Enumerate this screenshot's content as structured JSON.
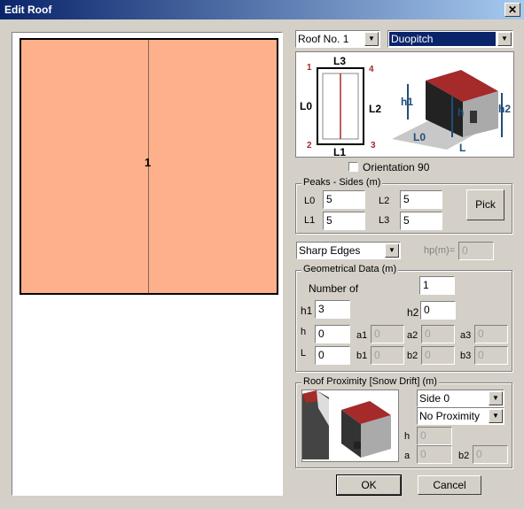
{
  "window": {
    "title": "Edit Roof",
    "close_label": "✕"
  },
  "canvas": {
    "roof_number_label": "1"
  },
  "roof_select": {
    "value": "Roof No. 1"
  },
  "roof_type_select": {
    "value": "Duopitch"
  },
  "diagram": {
    "labels": [
      "L3",
      "L0",
      "L2",
      "L1",
      "1",
      "4",
      "2",
      "3",
      "h1",
      "h",
      "h2",
      "L0",
      "L"
    ]
  },
  "orientation": {
    "label": "Orientation 90",
    "checked": false
  },
  "peaks_sides": {
    "title": "Peaks - Sides (m)",
    "L0": {
      "label": "L0",
      "value": "5"
    },
    "L2": {
      "label": "L2",
      "value": "5"
    },
    "L1": {
      "label": "L1",
      "value": "5"
    },
    "L3": {
      "label": "L3",
      "value": "5"
    },
    "pick_label": "Pick"
  },
  "edges_select": {
    "value": "Sharp Edges"
  },
  "hp": {
    "label": "hp(m)=",
    "value": "0"
  },
  "geometrical": {
    "title": "Geometrical Data (m)",
    "number_of_label": "Number of",
    "number_of_value": "1",
    "h1": {
      "label": "h1",
      "value": "3"
    },
    "h2": {
      "label": "h2",
      "value": "0"
    },
    "h": {
      "label": "h",
      "value": "0"
    },
    "L": {
      "label": "L",
      "value": "0"
    },
    "a1": {
      "label": "a1",
      "value": "0"
    },
    "a2": {
      "label": "a2",
      "value": "0"
    },
    "a3": {
      "label": "a3",
      "value": "0"
    },
    "b1": {
      "label": "b1",
      "value": "0"
    },
    "b2": {
      "label": "b2",
      "value": "0"
    },
    "b3": {
      "label": "b3",
      "value": "0"
    }
  },
  "proximity": {
    "title": "Roof Proximity [Snow Drift]  (m)",
    "side_select": "Side 0",
    "proximity_select": "No Proximity",
    "h": {
      "label": "h",
      "value": "0"
    },
    "a": {
      "label": "a",
      "value": "0"
    },
    "b2": {
      "label": "b2",
      "value": "0"
    }
  },
  "buttons": {
    "ok": "OK",
    "cancel": "Cancel"
  },
  "colors": {
    "roof_fill": "#fdb08a",
    "title_bar": "#0a246a",
    "selected": "#0a246a",
    "roof_red": "#a52a2a"
  }
}
